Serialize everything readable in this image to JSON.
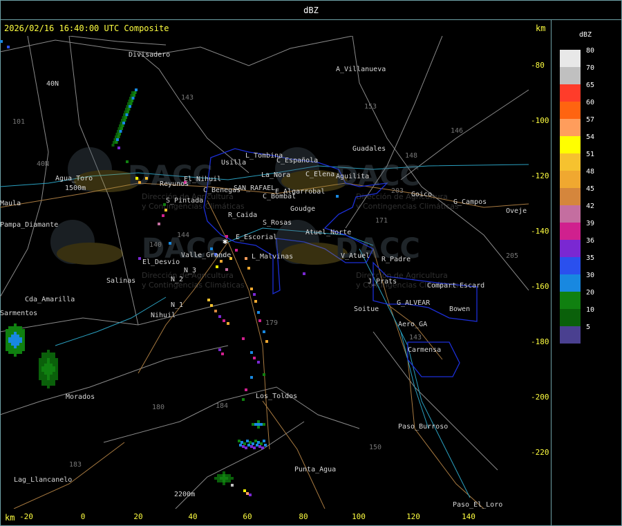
{
  "window": {
    "title": "dBZ"
  },
  "header": {
    "timestamp": "2026/02/16 16:40:00 UTC Composite",
    "unit": "km"
  },
  "axes": {
    "x_unit": "km",
    "x_ticks": [
      "-20",
      "0",
      "20",
      "40",
      "60",
      "80",
      "100",
      "120",
      "140"
    ],
    "y_ticks": [
      "-80",
      "-100",
      "-120",
      "-140",
      "-160",
      "-180",
      "-200",
      "-220"
    ]
  },
  "legend": {
    "title": "dBZ",
    "entries": [
      {
        "label": "80",
        "color": "#e8e8e8"
      },
      {
        "label": "70",
        "color": "#c0c0c0"
      },
      {
        "label": "65",
        "color": "#ff3c2a"
      },
      {
        "label": "60",
        "color": "#ff6410"
      },
      {
        "label": "57",
        "color": "#ff9d5c"
      },
      {
        "label": "54",
        "color": "#ffff00"
      },
      {
        "label": "51",
        "color": "#f6c22f"
      },
      {
        "label": "48",
        "color": "#f0a830"
      },
      {
        "label": "45",
        "color": "#d5863c"
      },
      {
        "label": "42",
        "color": "#c46ea0"
      },
      {
        "label": "39",
        "color": "#d0208e"
      },
      {
        "label": "36",
        "color": "#7a28d2"
      },
      {
        "label": "35",
        "color": "#2a50ee"
      },
      {
        "label": "30",
        "color": "#1888e0"
      },
      {
        "label": "20",
        "color": "#108010"
      },
      {
        "label": "10",
        "color": "#0a600a"
      },
      {
        "label": "5",
        "color": "#4a4090"
      }
    ]
  },
  "watermark": {
    "name": "DACC",
    "line1": "Dirección de Agricultura",
    "line2": "y Contingencias Climáticas"
  },
  "places": [
    {
      "name": "Divisadero"
    },
    {
      "name": "A_Villanueva"
    },
    {
      "name": "Guadales"
    },
    {
      "name": "L_Tombina"
    },
    {
      "name": "Usilla"
    },
    {
      "name": "C_Española"
    },
    {
      "name": "La_Nora"
    },
    {
      "name": "C_Elena"
    },
    {
      "name": "Aguilita"
    },
    {
      "name": "Agua_Toro"
    },
    {
      "name": "Reyunos"
    },
    {
      "name": "El_Nihuil"
    },
    {
      "name": "C_Benegas"
    },
    {
      "name": "SAN_RAFAEL"
    },
    {
      "name": "E_Algarrobal"
    },
    {
      "name": "C_Bombal"
    },
    {
      "name": "Goudge"
    },
    {
      "name": "Goico"
    },
    {
      "name": "G_Campos"
    },
    {
      "name": "S_Pintada"
    },
    {
      "name": "R_Caida"
    },
    {
      "name": "S_Rosas"
    },
    {
      "name": "Atuel_Norte"
    },
    {
      "name": "Pampa_Diamante"
    },
    {
      "name": "E_Escorial"
    },
    {
      "name": "Valle_Grande"
    },
    {
      "name": "L_Malvinas"
    },
    {
      "name": "V_Atuel"
    },
    {
      "name": "R_Padre"
    },
    {
      "name": "El_Desvio"
    },
    {
      "name": "Salinas"
    },
    {
      "name": "J_Prats"
    },
    {
      "name": "Compart"
    },
    {
      "name": "Escard"
    },
    {
      "name": "Cda_Amarilla"
    },
    {
      "name": "G_ALVEAR"
    },
    {
      "name": "Soitue"
    },
    {
      "name": "Bowen"
    },
    {
      "name": "Nihuil"
    },
    {
      "name": "Aero_GA"
    },
    {
      "name": "Carmensa"
    },
    {
      "name": "Morados"
    },
    {
      "name": "Los_Toldos"
    },
    {
      "name": "Paso_Burroso"
    },
    {
      "name": "Punta_Agua"
    },
    {
      "name": "Lag_Llancanelo"
    },
    {
      "name": "Paso_El_Loro"
    },
    {
      "name": "Oveje"
    },
    {
      "name": "Maula"
    },
    {
      "name": "Sarmentos"
    },
    {
      "name": "1500m"
    },
    {
      "name": "2200m"
    },
    {
      "name": "40N"
    },
    {
      "name": "N_1"
    },
    {
      "name": "N_2"
    },
    {
      "name": "N_3"
    }
  ],
  "route_labels": [
    "143",
    "153",
    "146",
    "148",
    "203",
    "171",
    "144",
    "101",
    "40N",
    "140",
    "184",
    "179",
    "180",
    "183",
    "150",
    "143",
    "205"
  ]
}
